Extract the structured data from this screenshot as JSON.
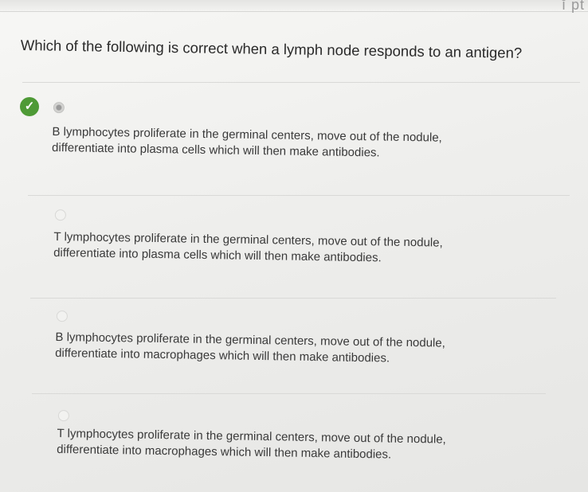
{
  "question": {
    "text": "Which of the following is correct when a lymph node responds to an antigen?"
  },
  "corner_text": "ĭ pt",
  "options": [
    {
      "text": "B lymphocytes proliferate in the germinal centers, move out of the nodule,\ndifferentiate into plasma cells which will then make antibodies.",
      "selected": true,
      "correct": true
    },
    {
      "text": "T lymphocytes proliferate in the germinal centers, move out of the nodule,\ndifferentiate into plasma cells which will then make antibodies.",
      "selected": false,
      "correct": false
    },
    {
      "text": "B lymphocytes proliferate in the germinal centers, move out of the nodule,\ndifferentiate into macrophages which will then make antibodies.",
      "selected": false,
      "correct": false
    },
    {
      "text": "T lymphocytes proliferate in the germinal centers, move out of the nodule,\ndifferentiate into macrophages which will then make antibodies.",
      "selected": false,
      "correct": false
    }
  ],
  "icons": {
    "correct_mark": "check-circle-icon"
  },
  "colors": {
    "correct_green": "#4e9a36"
  }
}
